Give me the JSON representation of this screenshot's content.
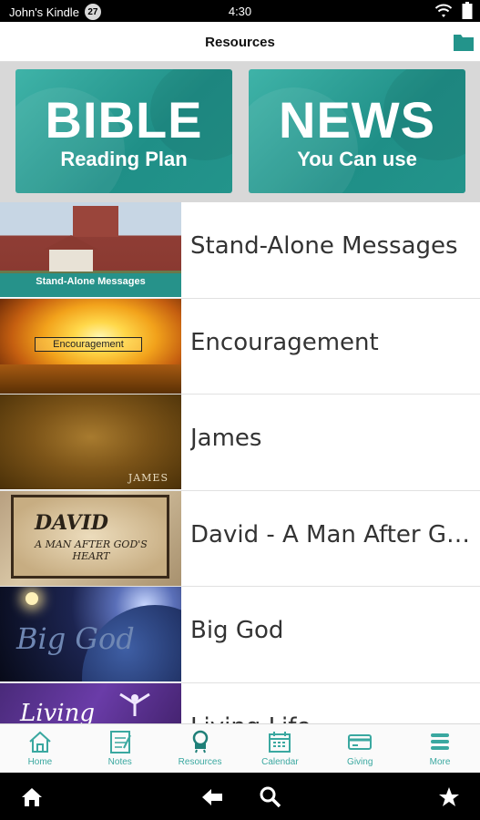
{
  "status_bar": {
    "device_name": "John's Kindle",
    "notification_count": "27",
    "time": "4:30"
  },
  "header": {
    "title": "Resources"
  },
  "feature_tiles": [
    {
      "big": "BIBLE",
      "small": "Reading Plan"
    },
    {
      "big": "NEWS",
      "small": "You Can use"
    }
  ],
  "series": [
    {
      "title": "Stand-Alone Messages",
      "thumb_caption": "Stand-Alone Messages"
    },
    {
      "title": "Encouragement",
      "thumb_caption": "Encouragement"
    },
    {
      "title": "James",
      "thumb_caption": "JAMES"
    },
    {
      "title": "David - A Man After God's Heart",
      "thumb_caption": "DAVID",
      "thumb_subcaption": "A MAN AFTER GOD'S HEART"
    },
    {
      "title": "Big God",
      "thumb_caption": "Big God"
    },
    {
      "title": "Living Life",
      "thumb_caption": "Living"
    }
  ],
  "tabs": [
    {
      "label": "Home",
      "icon": "home-icon"
    },
    {
      "label": "Notes",
      "icon": "notes-icon"
    },
    {
      "label": "Resources",
      "icon": "resources-icon"
    },
    {
      "label": "Calendar",
      "icon": "calendar-icon"
    },
    {
      "label": "Giving",
      "icon": "giving-icon"
    },
    {
      "label": "More",
      "icon": "more-icon"
    }
  ],
  "colors": {
    "accent": "#3aa8a0",
    "tile": "#23948b"
  }
}
